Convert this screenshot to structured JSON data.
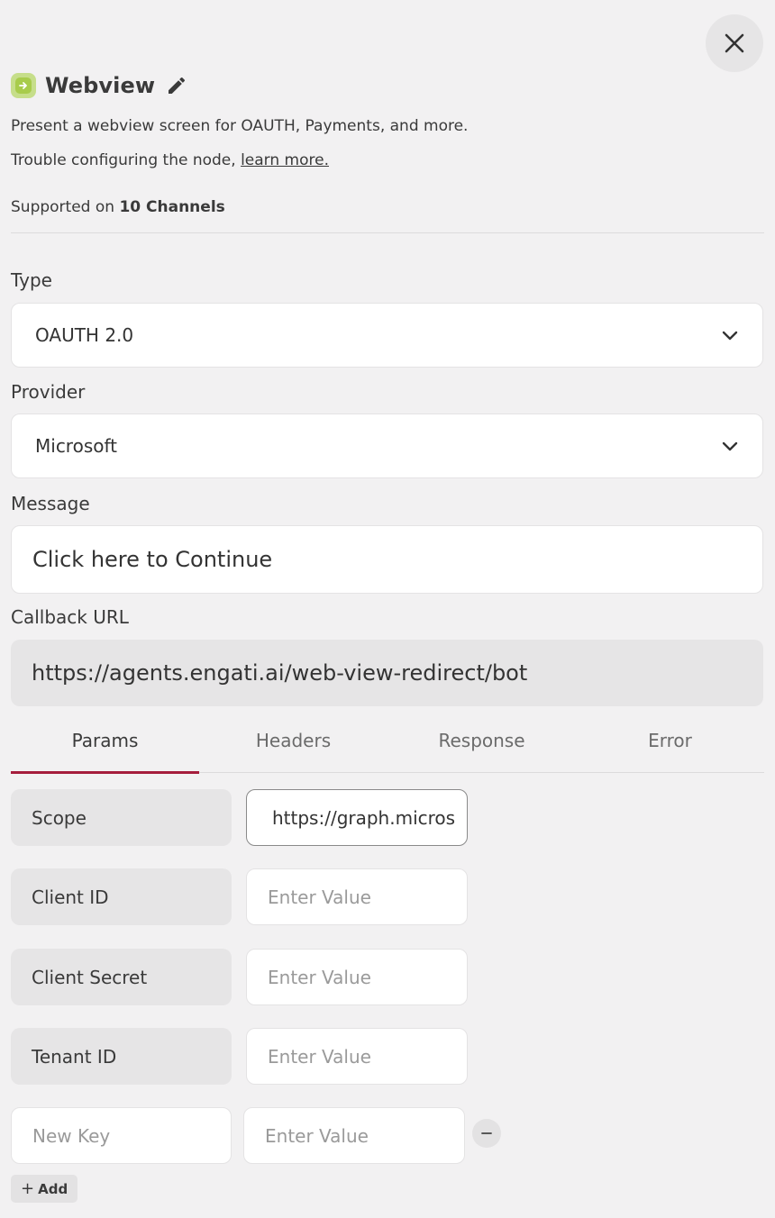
{
  "header": {
    "title": "Webview",
    "icon": "webview-node-icon",
    "accent": "#a8cc4c"
  },
  "description": {
    "line1": "Present a webview screen for OAUTH, Payments, and more.",
    "line2_prefix": "Trouble configuring the node,",
    "learn_more": "learn more."
  },
  "supported": {
    "prefix": "Supported on",
    "channels": "10 Channels"
  },
  "form": {
    "type_label": "Type",
    "type_value": "OAUTH 2.0",
    "provider_label": "Provider",
    "provider_value": "Microsoft",
    "message_label": "Message",
    "message_value": "Click here to Continue",
    "callback_label": "Callback URL",
    "callback_value": "https://agents.engati.ai/web-view-redirect/bot"
  },
  "tabs": [
    {
      "label": "Params",
      "active": true
    },
    {
      "label": "Headers",
      "active": false
    },
    {
      "label": "Response",
      "active": false
    },
    {
      "label": "Error",
      "active": false
    }
  ],
  "params": [
    {
      "key": "Scope",
      "value": "https://graph.micros",
      "placeholder": "Enter Value"
    },
    {
      "key": "Client ID",
      "value": "",
      "placeholder": "Enter Value"
    },
    {
      "key": "Client Secret",
      "value": "",
      "placeholder": "Enter Value"
    },
    {
      "key": "Tenant ID",
      "value": "",
      "placeholder": "Enter Value"
    }
  ],
  "new_param": {
    "key_placeholder": "New Key",
    "value_placeholder": "Enter Value"
  },
  "add_button": {
    "plus": "+",
    "label": "Add"
  },
  "colors": {
    "background": "#f2f1f2",
    "active_tab_underline": "#a51d3c"
  }
}
